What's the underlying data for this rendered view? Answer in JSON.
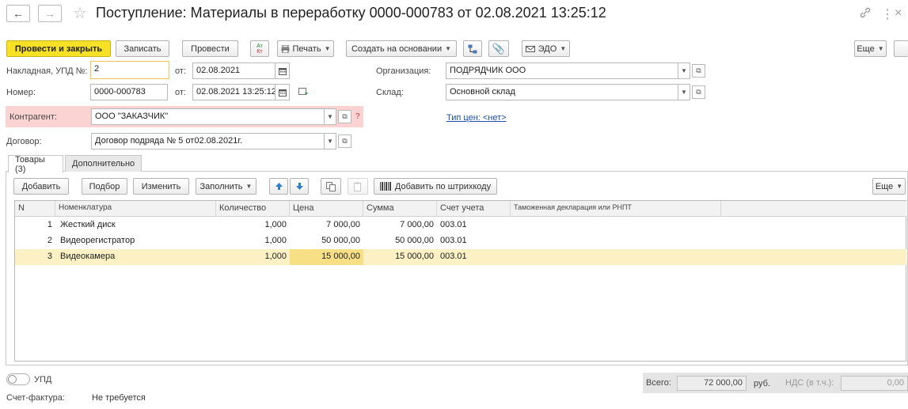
{
  "header": {
    "back": "←",
    "forward": "→",
    "star": "☆",
    "title": "Поступление: Материалы в переработку 0000-000783 от 02.08.2021 13:25:12",
    "link_icon": "🔗",
    "more_icon": "⋮",
    "close_icon": "×"
  },
  "toolbar": {
    "post_close": "Провести и закрыть",
    "write": "Записать",
    "post": "Провести",
    "dtkt_top": "Ат",
    "dtkt_bottom": "Кт",
    "print": "Печать",
    "create_based": "Создать на основании",
    "edo": "ЭДО",
    "more": "Еще"
  },
  "form": {
    "invoice_label": "Накладная, УПД №:",
    "invoice_value": "2",
    "from_label1": "от:",
    "date1": "02.08.2021",
    "number_label": "Номер:",
    "number_value": "0000-000783",
    "from_label2": "от:",
    "date2": "02.08.2021 13:25:12",
    "org_label": "Организация:",
    "org_value": "ПОДРЯДЧИК ООО",
    "warehouse_label": "Склад:",
    "warehouse_value": "Основной склад",
    "price_type_link": "Тип цен: <нет>",
    "counterparty_label": "Контрагент:",
    "counterparty_value": "ООО \"ЗАКАЗЧИК\"",
    "counterparty_hint": "?",
    "contract_label": "Договор:",
    "contract_value": "Договор подряда № 5 от02.08.2021г."
  },
  "tabs": [
    {
      "label": "Товары (3)"
    },
    {
      "label": "Дополнительно"
    }
  ],
  "table_toolbar": {
    "add": "Добавить",
    "pick": "Подбор",
    "edit": "Изменить",
    "fill": "Заполнить",
    "barcode": "Добавить по штрихкоду",
    "more": "Еще"
  },
  "table": {
    "headers": [
      "N",
      "Номенклатура",
      "Количество",
      "Цена",
      "Сумма",
      "Счет учета",
      "Таможенная декларация или РНПТ"
    ],
    "rows": [
      {
        "n": "1",
        "name": "Жесткий диск",
        "qty": "1,000",
        "price": "7 000,00",
        "sum": "7 000,00",
        "account": "003.01",
        "customs": ""
      },
      {
        "n": "2",
        "name": "Видеорегистратор",
        "qty": "1,000",
        "price": "50 000,00",
        "sum": "50 000,00",
        "account": "003.01",
        "customs": ""
      },
      {
        "n": "3",
        "name": "Видеокамера",
        "qty": "1,000",
        "price": "15 000,00",
        "sum": "15 000,00",
        "account": "003.01",
        "customs": ""
      }
    ]
  },
  "footer": {
    "upd_label": "УПД",
    "invoice_label": "Счет-фактура:",
    "invoice_value": "Не требуется",
    "total_label": "Всего:",
    "total_value": "72 000,00",
    "currency": "руб.",
    "vat_label": "НДС (в т.ч.):",
    "vat_value": "0,00"
  },
  "colors": {
    "primary_button": "#f6e127",
    "selected_row": "#fbf1c4",
    "selected_cell": "#f7df86",
    "error_zone": "#fbd3d3",
    "link": "#1a4ea8"
  }
}
